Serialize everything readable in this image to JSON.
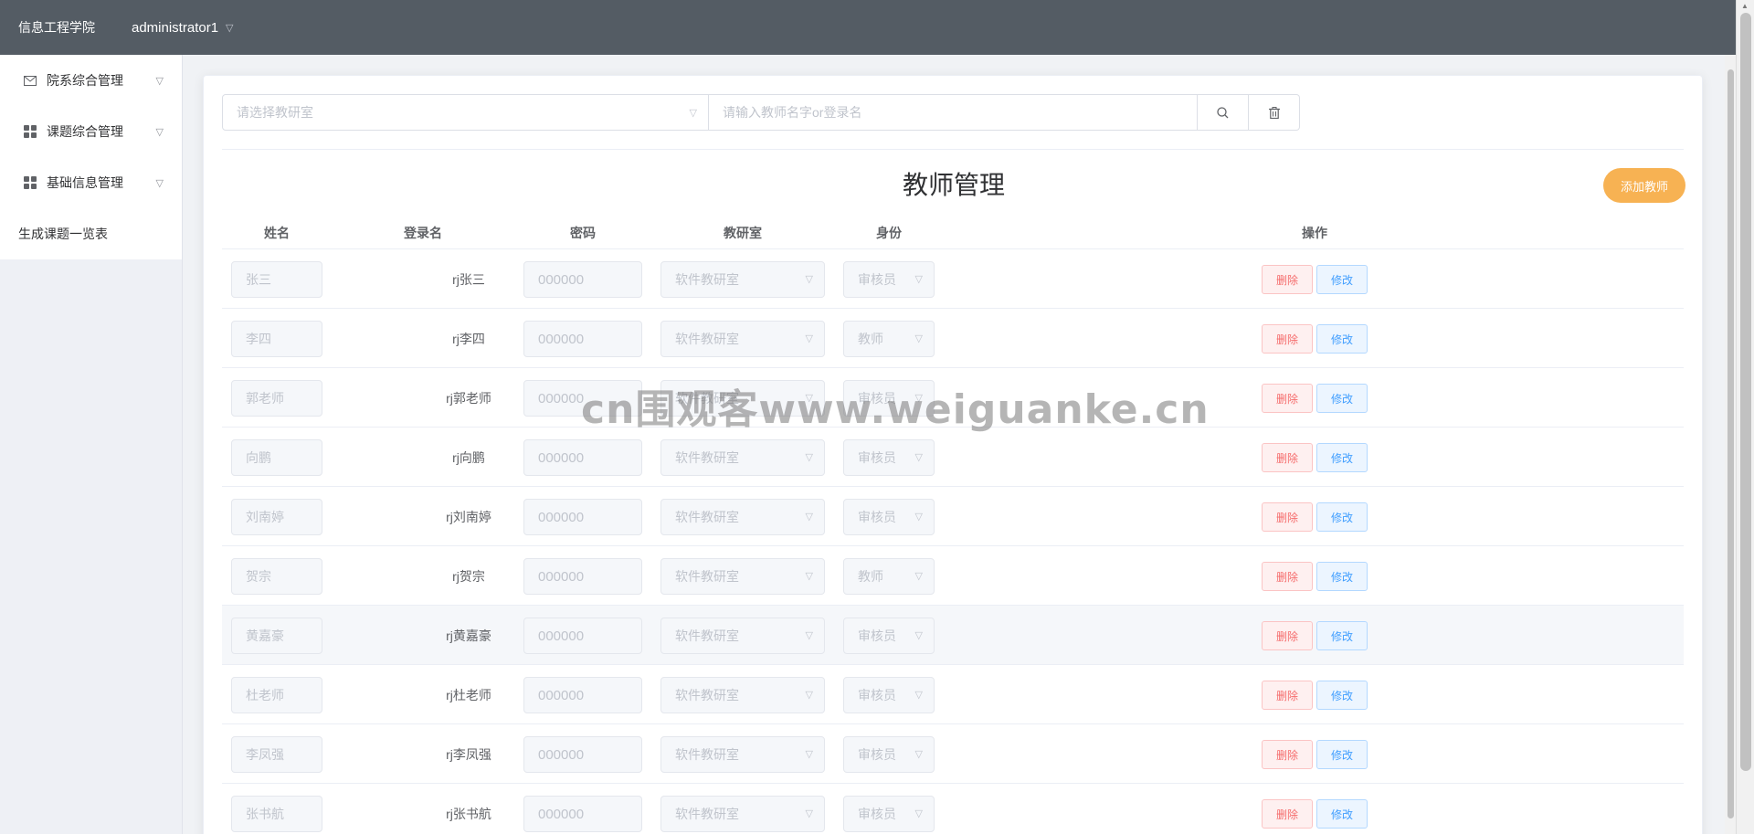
{
  "header": {
    "brand": "信息工程学院",
    "user": "administrator1"
  },
  "sidebar": {
    "menus": [
      {
        "label": "院系综合管理",
        "icon": "mail-icon"
      },
      {
        "label": "课题综合管理",
        "icon": "grid-icon"
      },
      {
        "label": "基础信息管理",
        "icon": "grid-icon"
      }
    ],
    "plain": "生成课题一览表"
  },
  "filters": {
    "room_placeholder": "请选择教研室",
    "search_placeholder": "请输入教师名字or登录名"
  },
  "page": {
    "title": "教师管理",
    "add_label": "添加教师"
  },
  "table": {
    "headers": {
      "name": "姓名",
      "login": "登录名",
      "password": "密码",
      "room": "教研室",
      "role": "身份",
      "action": "操作"
    },
    "rows": [
      {
        "name": "张三",
        "login": "rj张三",
        "password": "000000",
        "room": "软件教研室",
        "role": "审核员",
        "del": "删除",
        "edit": "修改"
      },
      {
        "name": "李四",
        "login": "rj李四",
        "password": "000000",
        "room": "软件教研室",
        "role": "教师",
        "del": "删除",
        "edit": "修改"
      },
      {
        "name": "郭老师",
        "login": "rj郭老师",
        "password": "000000",
        "room": "软件教研室",
        "role": "审核员",
        "del": "删除",
        "edit": "修改"
      },
      {
        "name": "向鹏",
        "login": "rj向鹏",
        "password": "000000",
        "room": "软件教研室",
        "role": "审核员",
        "del": "删除",
        "edit": "修改"
      },
      {
        "name": "刘南婷",
        "login": "rj刘南婷",
        "password": "000000",
        "room": "软件教研室",
        "role": "审核员",
        "del": "删除",
        "edit": "修改"
      },
      {
        "name": "贺宗",
        "login": "rj贺宗",
        "password": "000000",
        "room": "软件教研室",
        "role": "教师",
        "del": "删除",
        "edit": "修改"
      },
      {
        "name": "黄嘉豪",
        "login": "rj黄嘉豪",
        "password": "000000",
        "room": "软件教研室",
        "role": "审核员",
        "del": "删除",
        "edit": "修改"
      },
      {
        "name": "杜老师",
        "login": "rj杜老师",
        "password": "000000",
        "room": "软件教研室",
        "role": "审核员",
        "del": "删除",
        "edit": "修改"
      },
      {
        "name": "李凤强",
        "login": "rj李凤强",
        "password": "000000",
        "room": "软件教研室",
        "role": "审核员",
        "del": "删除",
        "edit": "修改"
      },
      {
        "name": "张书航",
        "login": "rj张书航",
        "password": "000000",
        "room": "软件教研室",
        "role": "审核员",
        "del": "删除",
        "edit": "修改"
      }
    ]
  },
  "watermark": "cn围观客www.weiguanke.cn",
  "colors": {
    "topbar": "#545c64",
    "accent": "#f7b253",
    "danger": "#f56c6c",
    "primary": "#409eff"
  }
}
